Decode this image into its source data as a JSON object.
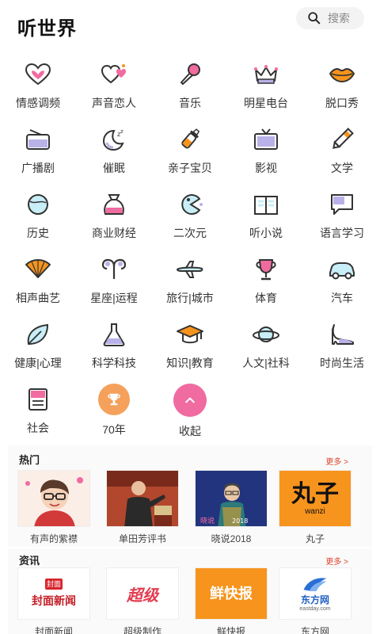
{
  "header": {
    "title": "听世界",
    "search_label": "搜索"
  },
  "categories": [
    {
      "label": "情感调频",
      "icon": "heart-icon"
    },
    {
      "label": "声音恋人",
      "icon": "hearts-icon"
    },
    {
      "label": "音乐",
      "icon": "microphone-icon"
    },
    {
      "label": "明星电台",
      "icon": "crown-icon"
    },
    {
      "label": "脱口秀",
      "icon": "lips-icon"
    },
    {
      "label": "广播剧",
      "icon": "radio-icon"
    },
    {
      "label": "催眠",
      "icon": "moon-icon"
    },
    {
      "label": "亲子宝贝",
      "icon": "baby-bottle-icon"
    },
    {
      "label": "影视",
      "icon": "tv-icon"
    },
    {
      "label": "文学",
      "icon": "pencil-icon"
    },
    {
      "label": "历史",
      "icon": "globe-icon"
    },
    {
      "label": "商业财经",
      "icon": "money-bag-icon"
    },
    {
      "label": "二次元",
      "icon": "pacman-icon"
    },
    {
      "label": "听小说",
      "icon": "book-icon"
    },
    {
      "label": "语言学习",
      "icon": "chat-icon"
    },
    {
      "label": "相声曲艺",
      "icon": "fan-icon"
    },
    {
      "label": "星座|运程",
      "icon": "aries-icon"
    },
    {
      "label": "旅行|城市",
      "icon": "airplane-icon"
    },
    {
      "label": "体育",
      "icon": "trophy-icon"
    },
    {
      "label": "汽车",
      "icon": "car-icon"
    },
    {
      "label": "健康|心理",
      "icon": "leaf-icon"
    },
    {
      "label": "科学科技",
      "icon": "flask-icon"
    },
    {
      "label": "知识|教育",
      "icon": "graduation-cap-icon"
    },
    {
      "label": "人文|社科",
      "icon": "planet-icon"
    },
    {
      "label": "时尚生活",
      "icon": "high-heel-icon"
    },
    {
      "label": "社会",
      "icon": "document-icon"
    },
    {
      "label": "70年",
      "icon": "trophy-badge-icon"
    },
    {
      "label": "收起",
      "icon": "chevron-up-icon"
    }
  ],
  "hot": {
    "title": "热门",
    "more": "更多 >",
    "items": [
      {
        "caption": "有声的紫襟"
      },
      {
        "caption": "单田芳评书"
      },
      {
        "caption": "晓说2018",
        "badge": "2018"
      },
      {
        "caption": "丸子",
        "logo_text": "丸子",
        "logo_sub": "wanzi"
      }
    ]
  },
  "news": {
    "title": "资讯",
    "more": "更多 >",
    "items": [
      {
        "caption": "封面新闻",
        "logo_text": "封面新闻"
      },
      {
        "caption": "超级制作",
        "logo_text": "超级"
      },
      {
        "caption": "鲜快报",
        "logo_text": "鲜快报"
      },
      {
        "caption": "东方网",
        "logo_text": "东方网",
        "logo_sub": "eastday.com"
      }
    ]
  },
  "colors": {
    "accent": "#f06ba0",
    "lavender": "#b9b2e8",
    "more": "#e0452f",
    "logo_orange": "#f7941d"
  }
}
